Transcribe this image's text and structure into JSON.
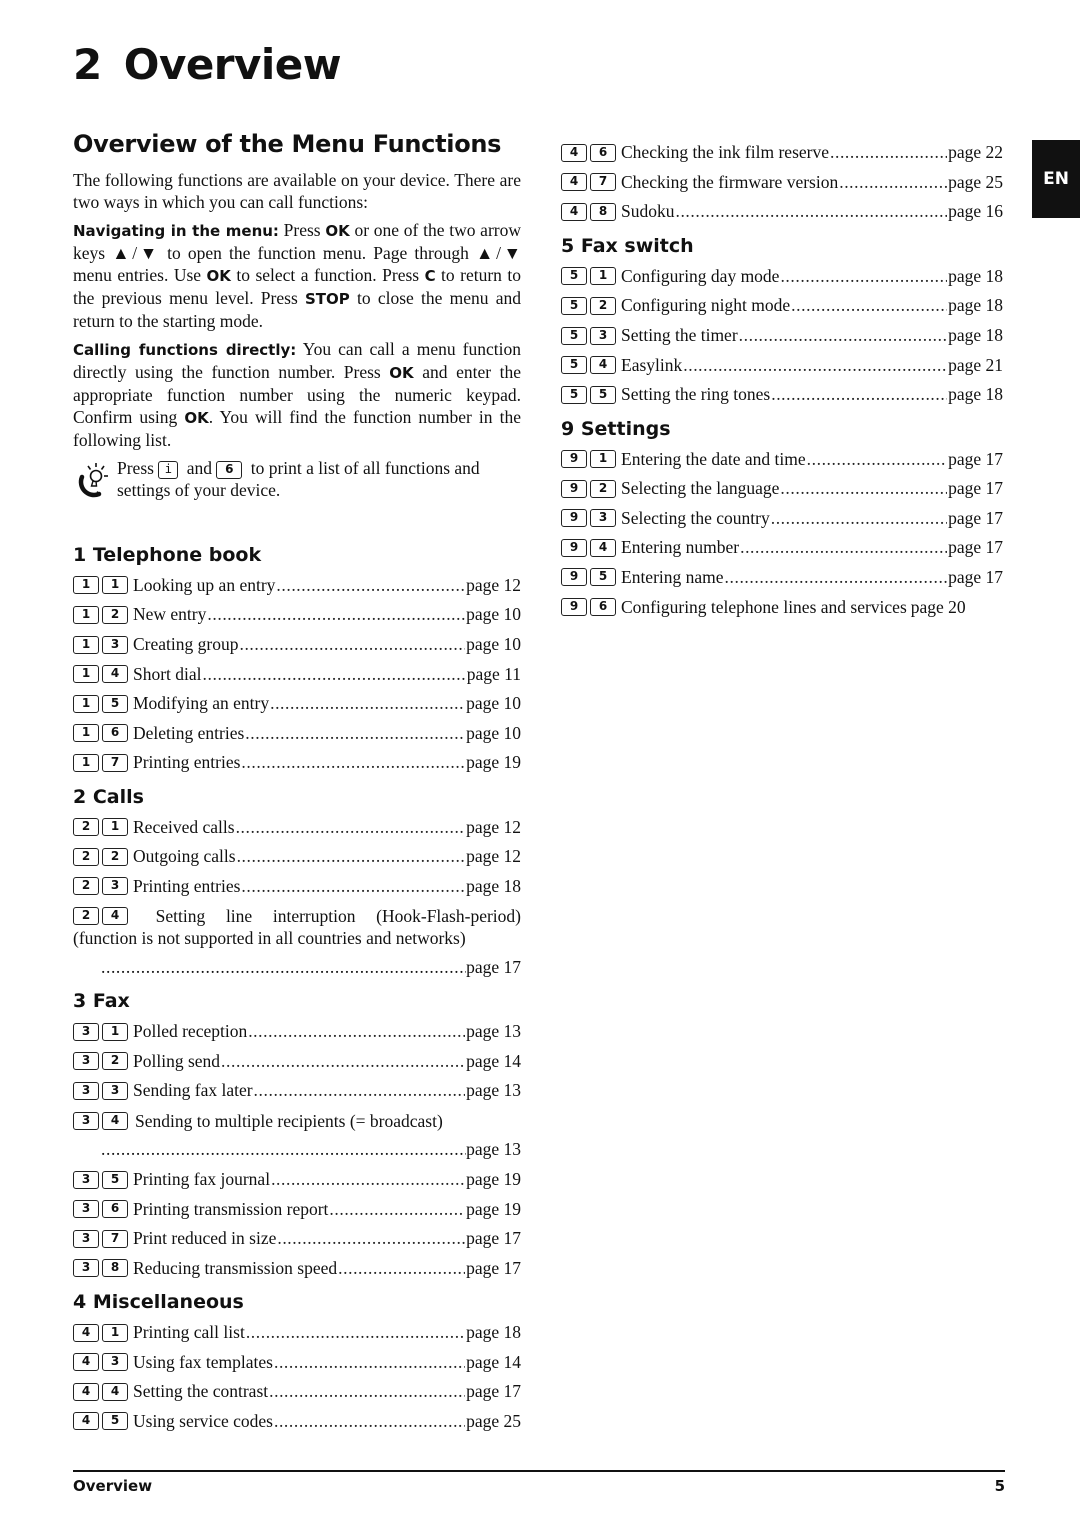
{
  "chapter": {
    "number": "2",
    "title": "Overview"
  },
  "section_title": "Overview of the Menu Functions",
  "intro": "The following functions are available on your device. There are two ways in which you can call functions:",
  "navigating": {
    "lead": "Navigating in the menu:",
    "parts": [
      " Press ",
      "OK",
      " or one of the two arrow keys ▲/▼ to open the function menu. Page through ▲/▼ menu entries. Use ",
      "OK",
      " to select a function. Press ",
      "C",
      " to return to the previous menu level. Press ",
      "STOP",
      " to close the menu and return to the starting mode."
    ]
  },
  "calling": {
    "lead": "Calling functions directly:",
    "parts": [
      " You can call a menu function directly using the function number. Press ",
      "OK",
      " and enter the appropriate function number using the numeric keypad. Confirm using ",
      "OK",
      ". You will find the function number in the following list."
    ]
  },
  "tip": {
    "icon": "lightbulb-tip-icon",
    "before": "Press ",
    "key1": "i",
    "middle": " and ",
    "key2": "6",
    "after": " to print a list of all functions and settings of your device."
  },
  "groups_left": [
    {
      "title": "1 Telephone book",
      "entries": [
        {
          "keys": [
            "1",
            "1"
          ],
          "label": "Looking up an entry",
          "page": "page 12"
        },
        {
          "keys": [
            "1",
            "2"
          ],
          "label": "New entry",
          "page": "page 10"
        },
        {
          "keys": [
            "1",
            "3"
          ],
          "label": "Creating group",
          "page": "page 10"
        },
        {
          "keys": [
            "1",
            "4"
          ],
          "label": "Short dial",
          "page": "page 11"
        },
        {
          "keys": [
            "1",
            "5"
          ],
          "label": "Modifying an entry",
          "page": "page 10"
        },
        {
          "keys": [
            "1",
            "6"
          ],
          "label": "Deleting entries",
          "page": "page 10"
        },
        {
          "keys": [
            "1",
            "7"
          ],
          "label": "Printing entries",
          "page": "page 19"
        }
      ]
    },
    {
      "title": "2 Calls",
      "entries": [
        {
          "keys": [
            "2",
            "1"
          ],
          "label": "Received calls",
          "page": "page 12"
        },
        {
          "keys": [
            "2",
            "2"
          ],
          "label": "Outgoing calls",
          "page": "page 12"
        },
        {
          "keys": [
            "2",
            "3"
          ],
          "label": "Printing entries",
          "page": "page 18"
        }
      ],
      "multi": {
        "keys": [
          "2",
          "4"
        ],
        "line1_words": [
          "Setting",
          "line",
          "interruption",
          "(Hook-Flash-period)"
        ],
        "line2": "(function is not supported in all countries and networks)",
        "page": "page 17"
      }
    },
    {
      "title": "3 Fax",
      "entries": [
        {
          "keys": [
            "3",
            "1"
          ],
          "label": "Polled reception",
          "page": "page 13"
        },
        {
          "keys": [
            "3",
            "2"
          ],
          "label": "Polling send",
          "page": "page 14"
        },
        {
          "keys": [
            "3",
            "3"
          ],
          "label": "Sending fax later",
          "page": "page 13"
        }
      ],
      "multi": {
        "keys": [
          "3",
          "4"
        ],
        "label": "Sending to multiple recipients (= broadcast)",
        "page": "page 13"
      },
      "entries_after": [
        {
          "keys": [
            "3",
            "5"
          ],
          "label": "Printing fax journal",
          "page": "page 19"
        },
        {
          "keys": [
            "3",
            "6"
          ],
          "label": "Printing transmission report",
          "page": "page 19"
        },
        {
          "keys": [
            "3",
            "7"
          ],
          "label": "Print reduced in size",
          "page": "page 17"
        },
        {
          "keys": [
            "3",
            "8"
          ],
          "label": "Reducing transmission speed",
          "page": "page 17"
        }
      ]
    },
    {
      "title": "4 Miscellaneous",
      "entries": [
        {
          "keys": [
            "4",
            "1"
          ],
          "label": "Printing call list",
          "page": "page 18"
        },
        {
          "keys": [
            "4",
            "3"
          ],
          "label": "Using fax templates",
          "page": "page 14"
        },
        {
          "keys": [
            "4",
            "4"
          ],
          "label": "Setting the contrast",
          "page": "page 17"
        },
        {
          "keys": [
            "4",
            "5"
          ],
          "label": "Using service codes",
          "page": "page 25"
        }
      ]
    }
  ],
  "misc_continued": [
    {
      "keys": [
        "4",
        "6"
      ],
      "label": "Checking the ink film reserve",
      "page": "page 22"
    },
    {
      "keys": [
        "4",
        "7"
      ],
      "label": "Checking the firmware version",
      "page": "page 25"
    },
    {
      "keys": [
        "4",
        "8"
      ],
      "label": "Sudoku",
      "page": "page 16"
    }
  ],
  "groups_right": [
    {
      "title": "5 Fax switch",
      "entries": [
        {
          "keys": [
            "5",
            "1"
          ],
          "label": "Configuring day mode",
          "page": "page 18"
        },
        {
          "keys": [
            "5",
            "2"
          ],
          "label": "Configuring night mode",
          "page": "page 18"
        },
        {
          "keys": [
            "5",
            "3"
          ],
          "label": "Setting the timer",
          "page": "page 18"
        },
        {
          "keys": [
            "5",
            "4"
          ],
          "label": "Easylink",
          "page": "page 21"
        },
        {
          "keys": [
            "5",
            "5"
          ],
          "label": "Setting the ring tones",
          "page": "page 18"
        }
      ]
    },
    {
      "title": "9 Settings",
      "entries": [
        {
          "keys": [
            "9",
            "1"
          ],
          "label": "Entering the date and time",
          "page": "page 17"
        },
        {
          "keys": [
            "9",
            "2"
          ],
          "label": "Selecting the language",
          "page": "page 17"
        },
        {
          "keys": [
            "9",
            "3"
          ],
          "label": "Selecting the country",
          "page": "page 17"
        },
        {
          "keys": [
            "9",
            "4"
          ],
          "label": "Entering number",
          "page": "page 17"
        },
        {
          "keys": [
            "9",
            "5"
          ],
          "label": "Entering name",
          "page": "page 17"
        },
        {
          "keys": [
            "9",
            "6"
          ],
          "label": "Configuring telephone lines and services",
          "page": "page 20",
          "nodots": true
        }
      ]
    }
  ],
  "language_tab": "EN",
  "footer": {
    "section": "Overview",
    "page_number": "5"
  }
}
